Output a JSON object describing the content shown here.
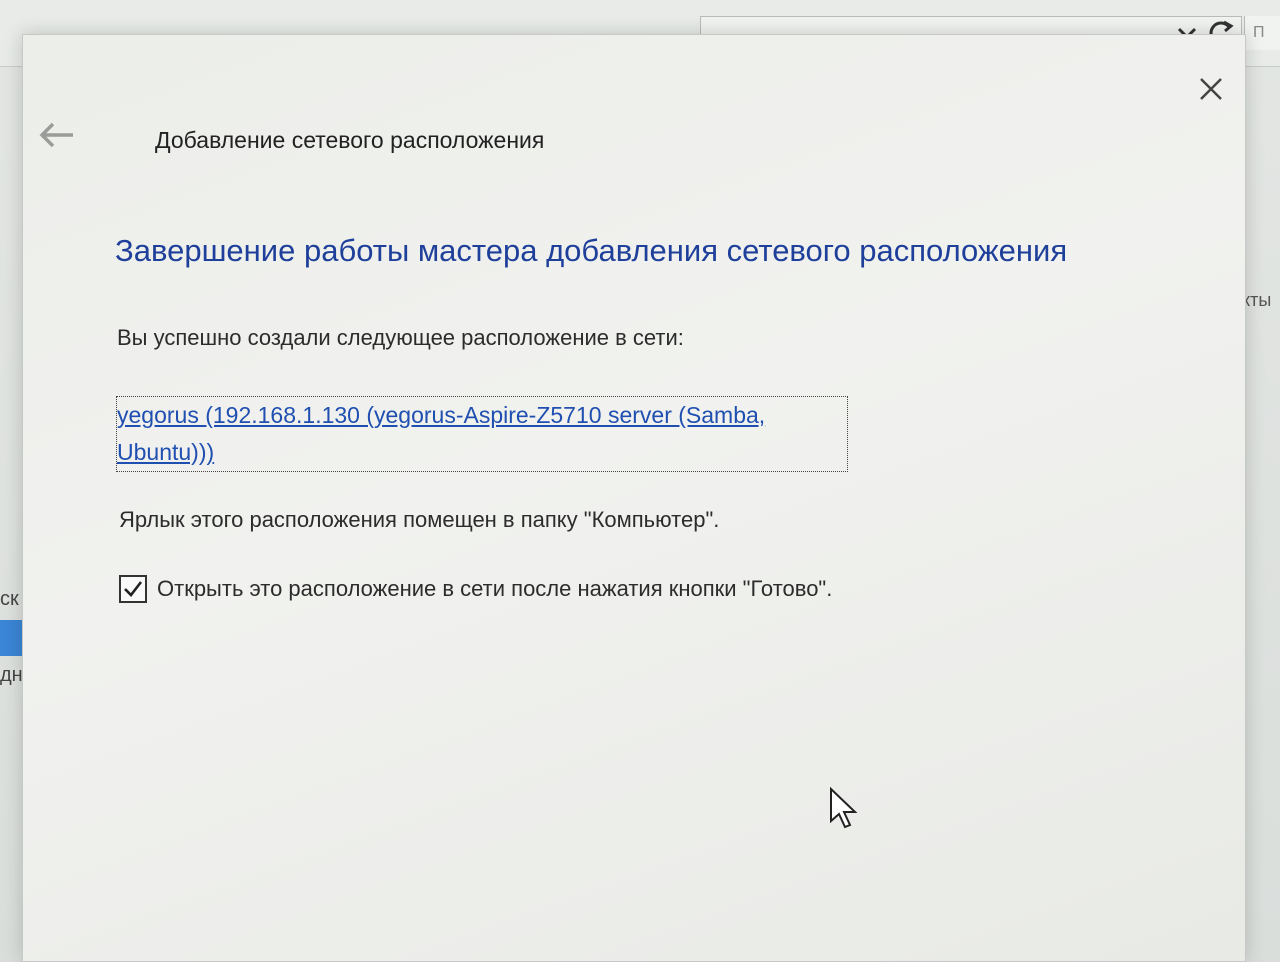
{
  "background": {
    "search_hint": "П",
    "left_texts": [
      "ск",
      "дно"
    ],
    "right_text": "кты"
  },
  "dialog": {
    "title": "Добавление сетевого расположения",
    "heading": "Завершение работы мастера добавления сетевого расположения",
    "success_text": "Вы успешно создали следующее расположение в сети:",
    "link_line1": "yegorus (192.168.1.130 (yegorus-Aspire-Z5710 server (Samba,",
    "link_line2": "Ubuntu)))",
    "shortcut_text": "Ярлык этого расположения помещен в папку \"Компьютер\".",
    "checkbox_label": "Открыть это расположение в сети после нажатия кнопки \"Готово\".",
    "checkbox_checked": true,
    "close_glyph": "✕"
  },
  "colors": {
    "heading": "#1e3f9a",
    "link": "#1f4fb0",
    "selection": "#3b86d6"
  }
}
